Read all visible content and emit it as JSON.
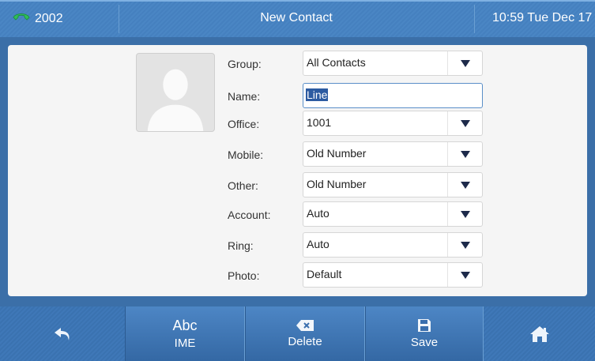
{
  "header": {
    "account": "2002",
    "title": "New Contact",
    "clock": "10:59 Tue Dec 17"
  },
  "form": {
    "fields": [
      {
        "label": "Group:",
        "value": "All Contacts",
        "type": "select"
      },
      {
        "label": "Name:",
        "value": "Line",
        "type": "input"
      },
      {
        "label": "Office:",
        "value": "1001",
        "type": "select"
      },
      {
        "label": "Mobile:",
        "value": "Old Number",
        "type": "select"
      },
      {
        "label": "Other:",
        "value": "Old Number",
        "type": "select"
      },
      {
        "label": "Account:",
        "value": "Auto",
        "type": "select"
      },
      {
        "label": "Ring:",
        "value": "Auto",
        "type": "select"
      },
      {
        "label": "Photo:",
        "value": "Default",
        "type": "select"
      }
    ]
  },
  "softkeys": {
    "back_icon": "back-arrow-icon",
    "ime_top": "Abc",
    "ime_label": "IME",
    "delete_label": "Delete",
    "save_label": "Save",
    "home_icon": "home-icon"
  },
  "colors": {
    "bar": "#4a86c4",
    "panel": "#f5f5f5",
    "selection": "#2c5ba1"
  }
}
